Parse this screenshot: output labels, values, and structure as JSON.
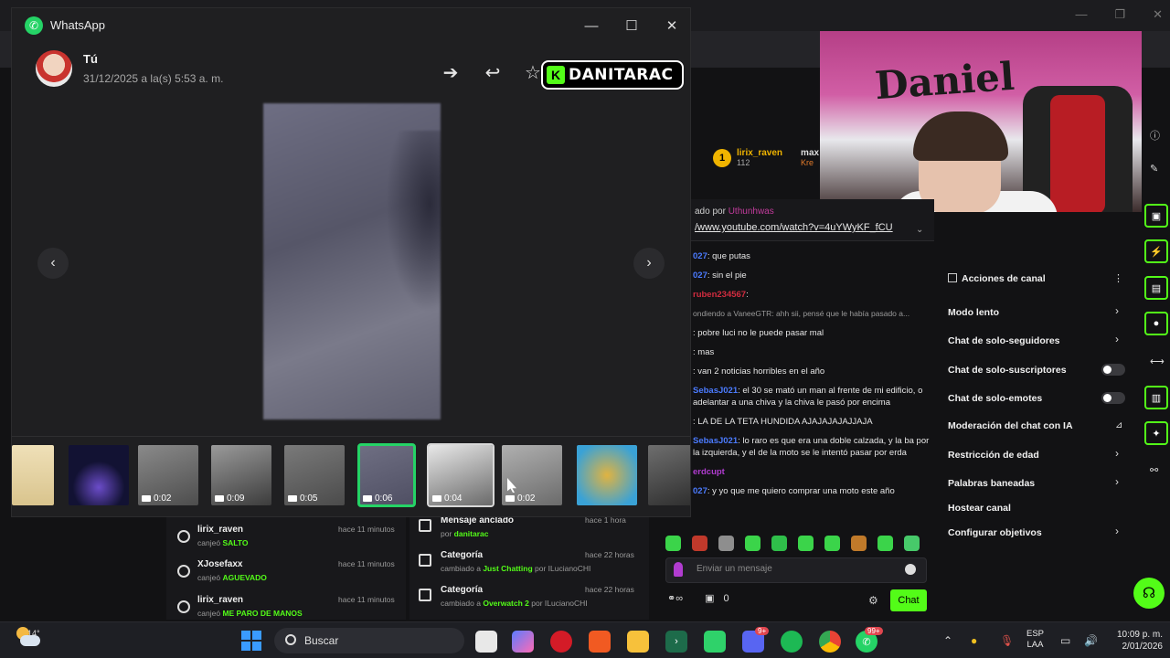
{
  "whatsapp": {
    "app_title": "WhatsApp",
    "sender": "Tú",
    "timestamp": "31/12/2025 a la(s) 5:53 a. m.",
    "thumbnails": [
      {
        "kind": "image",
        "duration": ""
      },
      {
        "kind": "image",
        "duration": ""
      },
      {
        "kind": "video",
        "duration": "0:02"
      },
      {
        "kind": "video",
        "duration": "0:09"
      },
      {
        "kind": "video",
        "duration": "0:05"
      },
      {
        "kind": "video",
        "duration": "0:06"
      },
      {
        "kind": "video",
        "duration": "0:04"
      },
      {
        "kind": "video",
        "duration": "0:02"
      },
      {
        "kind": "image",
        "duration": ""
      },
      {
        "kind": "video",
        "duration": ""
      }
    ],
    "selected_thumbnail_index": 5,
    "colors": {
      "accent": "#25d366",
      "bg": "#1f1f21"
    }
  },
  "stream": {
    "logo_text": "DANITARAC",
    "logo_letter": "K",
    "accent": "#53fc18"
  },
  "chat": {
    "viewer": {
      "name": "lirix_raven",
      "sub": "112",
      "badge": "1",
      "extra": "max",
      "extra2": "Kre"
    },
    "pinned_by_label": "ado por",
    "pinned_by_name": "Uthunhwas",
    "pinned_link": "/www.youtube.com/watch?v=4uYWyKF_fCU",
    "lines": [
      {
        "user": "",
        "text": "",
        "cls": ""
      },
      {
        "user": "027",
        "text": ": que putas",
        "cls": ""
      },
      {
        "user": "027",
        "text": ": sin el pie",
        "cls": ""
      },
      {
        "user": "ruben234567",
        "text": ":",
        "cls": "red"
      },
      {
        "user": "",
        "text": "ondiendo a VaneeGTR: ahh sii, pensé que le había pasado a...",
        "cls": "small"
      },
      {
        "user": "",
        "text": ": pobre luci no le puede pasar mal",
        "cls": ""
      },
      {
        "user": "",
        "text": ": mas",
        "cls": ""
      },
      {
        "user": "",
        "text": ": van 2 noticias horribles en el año",
        "cls": ""
      },
      {
        "user": "SebasJ021",
        "text": ": el 30 se mató un man al frente de mi edificio, o adelantar a una chiva y la chiva le pasó por encima",
        "cls": ""
      },
      {
        "user": "",
        "text": ": LA DE LA TETA HUNDIDA AJAJAJAJAJJAJA",
        "cls": ""
      },
      {
        "user": "SebasJ021",
        "text": ": lo raro es que era una doble calzada, y la ba por la izquierda, y el de la moto se le intentó pasar por erda",
        "cls": ""
      },
      {
        "user": "erdcupt",
        "text": "",
        "cls": "mag"
      },
      {
        "user": "027",
        "text": ": y yo que me quiero comprar una moto este año",
        "cls": ""
      }
    ],
    "input_placeholder": "Enviar un mensaje",
    "bottom_count": "0",
    "chat_button": "Chat"
  },
  "actions": {
    "title": "Acciones de canal",
    "items": [
      {
        "label": "Modo lento",
        "control": "chevron"
      },
      {
        "label": "Chat de solo-seguidores",
        "control": "chevron"
      },
      {
        "label": "Chat de solo-suscriptores",
        "control": "toggle"
      },
      {
        "label": "Chat de solo-emotes",
        "control": "toggle"
      },
      {
        "label": "Moderación del chat con IA",
        "control": "ai"
      },
      {
        "label": "Restricción de edad",
        "control": "chevron"
      },
      {
        "label": "Palabras baneadas",
        "control": "chevron"
      },
      {
        "label": "Hostear canal",
        "control": "none"
      },
      {
        "label": "Configurar objetivos",
        "control": "chevron"
      }
    ]
  },
  "activity_left": [
    {
      "name": "lirix_raven",
      "verb": "canjeó",
      "reward": "SALTO",
      "time": "hace 11 minutos"
    },
    {
      "name": "XJosefaxx",
      "verb": "canjeó",
      "reward": "AGUEVADO",
      "time": "hace 11 minutos"
    },
    {
      "name": "lirix_raven",
      "verb": "canjeó",
      "reward": "ME PARO DE MANOS",
      "time": "hace 11 minutos"
    }
  ],
  "activity_mid": [
    {
      "name": "Mensaje anclado",
      "desc_pre": "por",
      "desc_hi": "danitarac",
      "desc_post": "",
      "time": "hace 1 hora"
    },
    {
      "name": "Categoría",
      "desc_pre": "cambiado a",
      "desc_hi": "Just Chatting",
      "desc_post": " por ILucianoCHI",
      "time": "hace 22 horas"
    },
    {
      "name": "Categoría",
      "desc_pre": "cambiado a",
      "desc_hi": "Overwatch 2",
      "desc_post": " por ILucianoCHI",
      "time": "hace 22 horas"
    }
  ],
  "taskbar": {
    "temperature": "14°",
    "search_label": "Buscar",
    "lang_top": "ESP",
    "lang_bottom": "LAA",
    "time": "10:09 p. m.",
    "date": "2/01/2026",
    "discord_badge": "9+",
    "whatsapp_badge": "99+"
  }
}
